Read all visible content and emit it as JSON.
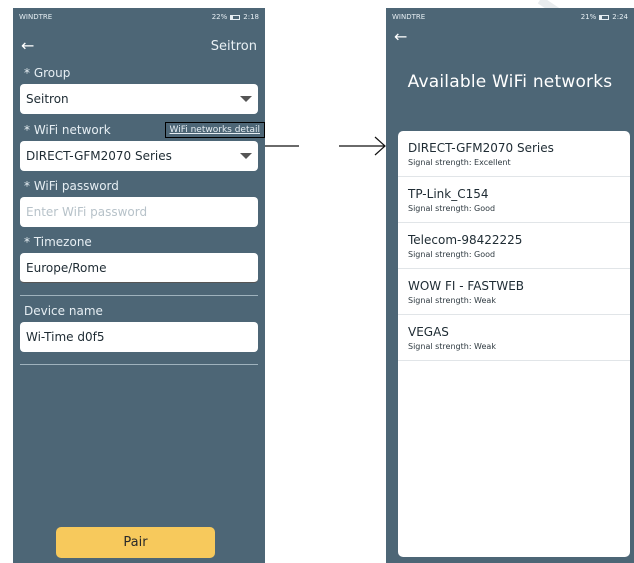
{
  "left_screen": {
    "status": {
      "carrier": "WINDTRE",
      "right": "22%",
      "time": "2:18"
    },
    "header": {
      "title": "Seitron"
    },
    "group": {
      "label": "* Group",
      "value": "Seitron"
    },
    "wifi_network": {
      "label": "* WiFi network",
      "detail_link": "WiFi networks detail",
      "value": "DIRECT-GFM2070 Series"
    },
    "wifi_password": {
      "label": "* WiFi password",
      "placeholder": "Enter WiFi password"
    },
    "timezone": {
      "label": "* Timezone",
      "value": "Europe/Rome"
    },
    "device_name": {
      "label": "Device name",
      "value": "Wi-Time d0f5"
    },
    "pair_button": "Pair",
    "accent_color": "#f7c95c",
    "background_color": "#4d6676"
  },
  "right_screen": {
    "status": {
      "carrier": "WINDTRE",
      "right": "21%",
      "time": "2:24"
    },
    "title": "Available WiFi networks",
    "networks": [
      {
        "name": "DIRECT-GFM2070 Series",
        "signal": "Signal strength: Excellent"
      },
      {
        "name": "TP-Link_C154",
        "signal": "Signal strength: Good"
      },
      {
        "name": "Telecom-98422225",
        "signal": "Signal strength: Good"
      },
      {
        "name": "WOW FI - FASTWEB",
        "signal": "Signal strength: Weak"
      },
      {
        "name": "VEGAS",
        "signal": "Signal strength: Weak"
      }
    ]
  },
  "icons": [
    "back-arrow-icon",
    "dropdown-caret-icon",
    "battery-icon",
    "signal-icon"
  ]
}
